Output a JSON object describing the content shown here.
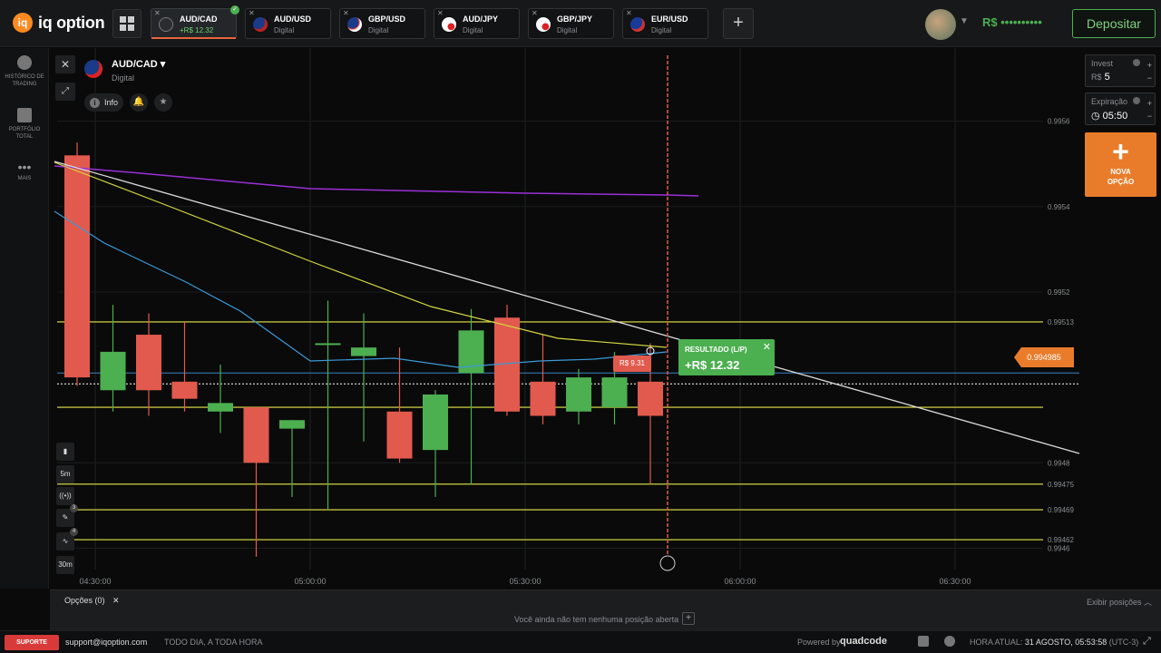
{
  "app": {
    "logo_text": "iq option"
  },
  "tabs": [
    {
      "pair": "AUD/CAD",
      "sub": "+R$ 12.32",
      "active": true
    },
    {
      "pair": "AUD/USD",
      "sub": "Digital"
    },
    {
      "pair": "GBP/USD",
      "sub": "Digital"
    },
    {
      "pair": "AUD/JPY",
      "sub": "Digital"
    },
    {
      "pair": "GBP/JPY",
      "sub": "Digital"
    },
    {
      "pair": "EUR/USD",
      "sub": "Digital"
    }
  ],
  "header": {
    "balance": "R$ ••••••••••",
    "deposit_label": "Depositar"
  },
  "sidebar": {
    "items": [
      {
        "label": "HISTÓRICO DE TRADING",
        "icon": "clock-icon"
      },
      {
        "label": "PORTFÓLIO TOTAL",
        "icon": "briefcase-icon"
      },
      {
        "label": "MAIS",
        "icon": "more-icon"
      }
    ]
  },
  "asset": {
    "name": "AUD/CAD",
    "type": "Digital",
    "info_label": "Info"
  },
  "tools": [
    "5m",
    "30m"
  ],
  "tool_badges": [
    "3",
    "4"
  ],
  "right_panel": {
    "invest_label": "Invest",
    "invest_value": "5",
    "currency": "R$",
    "expiry_label": "Expiração",
    "expiry_value": "05:50",
    "new_option_label": "NOVA OPÇÃO"
  },
  "price_axis": [
    "0.9956",
    "0.9954",
    "0.9952",
    "0.99513",
    "0.9948",
    "0.99475",
    "0.99469",
    "0.99462",
    "0.9946"
  ],
  "current_price": "0.994985",
  "time_axis": [
    "04:30:00",
    "05:00:00",
    "05:30:00",
    "06:00:00",
    "06:30:00"
  ],
  "result": {
    "title": "RESULTADO (L/P)",
    "value": "+R$ 12.32"
  },
  "trade_label": "R$ 9.31",
  "bottom": {
    "options_label": "Opções (0)",
    "show_positions": "Exibir posições",
    "no_positions": "Você ainda não tem nenhuma posição aberta"
  },
  "footer": {
    "support": "SUPORTE",
    "email": "support@iqoption.com",
    "slogan": "TODO DIA, A TODA HORA",
    "powered": "Powered by",
    "powered_brand": "quadcode",
    "time_label": "HORA ATUAL:",
    "time_value": "31 AGOSTO, 05:53:58",
    "timezone": "(UTC-3)"
  },
  "colors": {
    "accent": "#e97c2a",
    "up": "#4caf50",
    "down": "#e15a4d",
    "level": "#e6e64a"
  },
  "chart_data": {
    "type": "candlestick",
    "x": [
      "04:30",
      "04:35",
      "04:40",
      "04:45",
      "04:50",
      "04:55",
      "05:00",
      "05:05",
      "05:10",
      "05:15",
      "05:20",
      "05:25",
      "05:30",
      "05:35",
      "05:40",
      "05:45",
      "05:50"
    ],
    "open": [
      0.99552,
      0.99497,
      0.9951,
      0.99499,
      0.99492,
      0.99493,
      0.99488,
      0.99508,
      0.99505,
      0.99492,
      0.99483,
      0.99501,
      0.99514,
      0.99499,
      0.99492,
      0.99493,
      0.99499
    ],
    "high": [
      0.99555,
      0.99517,
      0.99515,
      0.99513,
      0.99503,
      0.9949,
      0.9949,
      0.99518,
      0.99515,
      0.99507,
      0.99497,
      0.99516,
      0.99517,
      0.9951,
      0.99502,
      0.99506,
      0.99508
    ],
    "low": [
      0.99498,
      0.99492,
      0.99491,
      0.99492,
      0.99487,
      0.99458,
      0.99472,
      0.99469,
      0.99485,
      0.9948,
      0.99472,
      0.99475,
      0.99491,
      0.99489,
      0.99489,
      0.99489,
      0.99475
    ],
    "close": [
      0.995,
      0.99506,
      0.99497,
      0.99495,
      0.99494,
      0.9948,
      0.9949,
      0.99508,
      0.99507,
      0.99481,
      0.99496,
      0.99511,
      0.99492,
      0.99491,
      0.995,
      0.995,
      0.99491
    ],
    "levels": [
      0.99513,
      0.99493,
      0.99475,
      0.99469,
      0.99462
    ],
    "ylim": [
      0.99455,
      0.99575
    ]
  }
}
